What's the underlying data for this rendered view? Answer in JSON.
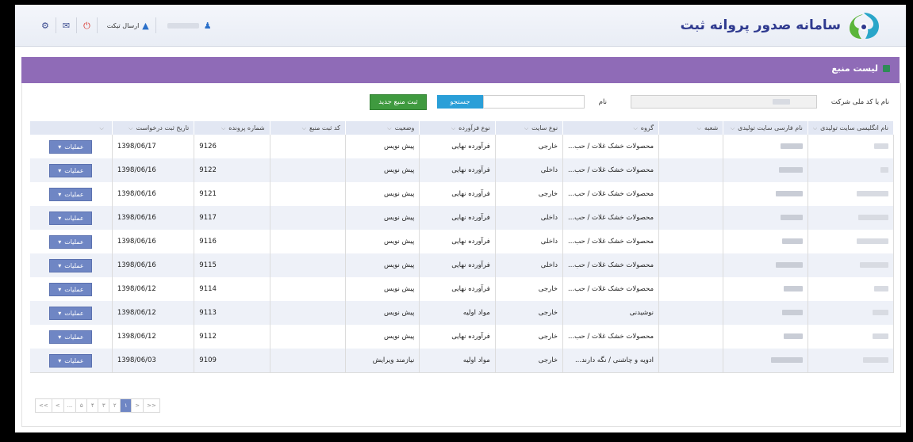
{
  "header": {
    "brand_title": "سامانه صدور پروانه ثبت",
    "send_ticket_label": "ارسال تیکت"
  },
  "page": {
    "title": "لیست منبع"
  },
  "search": {
    "company_label": "نام یا کد ملی شرکت",
    "name_label": "نام",
    "search_button": "جستجو",
    "new_button": "ثبت منبع جدید"
  },
  "table": {
    "columns": [
      "نام انگلیسی سایت تولیدی",
      "نام فارسی سایت تولیدی",
      "شعبه",
      "گروه",
      "نوع سایت",
      "نوع فرآورده",
      "وضعیت",
      "کد ثبت منبع",
      "شماره پرونده",
      "تاریخ ثبت درخواست",
      ""
    ],
    "ops_label": "عملیات",
    "rows": [
      {
        "group": "محصولات خشک غلات / حب...",
        "site_type": "خارجی",
        "product_type": "فرآورده نهایی",
        "status": "پیش نویس",
        "file_no": "9126",
        "date": "1398/06/17"
      },
      {
        "group": "محصولات خشک غلات / حب...",
        "site_type": "داخلی",
        "product_type": "فرآورده نهایی",
        "status": "پیش نویس",
        "file_no": "9122",
        "date": "1398/06/16"
      },
      {
        "group": "محصولات خشک غلات / حب...",
        "site_type": "خارجی",
        "product_type": "فرآورده نهایی",
        "status": "پیش نویس",
        "file_no": "9121",
        "date": "1398/06/16"
      },
      {
        "group": "محصولات خشک غلات / حب...",
        "site_type": "داخلی",
        "product_type": "فرآورده نهایی",
        "status": "پیش نویس",
        "file_no": "9117",
        "date": "1398/06/16"
      },
      {
        "group": "محصولات خشک غلات / حب...",
        "site_type": "داخلی",
        "product_type": "فرآورده نهایی",
        "status": "پیش نویس",
        "file_no": "9116",
        "date": "1398/06/16"
      },
      {
        "group": "محصولات خشک غلات / حب...",
        "site_type": "داخلی",
        "product_type": "فرآورده نهایی",
        "status": "پیش نویس",
        "file_no": "9115",
        "date": "1398/06/16"
      },
      {
        "group": "محصولات خشک غلات / حب...",
        "site_type": "خارجی",
        "product_type": "فرآورده نهایی",
        "status": "پیش نویس",
        "file_no": "9114",
        "date": "1398/06/12"
      },
      {
        "group": "نوشیدنی",
        "site_type": "خارجی",
        "product_type": "مواد اولیه",
        "status": "پیش نویس",
        "file_no": "9113",
        "date": "1398/06/12"
      },
      {
        "group": "محصولات خشک غلات / حب...",
        "site_type": "خارجی",
        "product_type": "فرآورده نهایی",
        "status": "پیش نویس",
        "file_no": "9112",
        "date": "1398/06/12"
      },
      {
        "group": "ادویه و چاشنی / نگه دارند...",
        "site_type": "خارجی",
        "product_type": "مواد اولیه",
        "status": "نیازمند ویرایش",
        "file_no": "9109",
        "date": "1398/06/03"
      }
    ]
  },
  "pagination": {
    "items": [
      "<<",
      "<",
      "...",
      "۵",
      "۴",
      "۳",
      "۲",
      "۱",
      ">",
      ">>"
    ],
    "active_index": 7
  },
  "colors": {
    "title_bar": "#8f6bb7",
    "header_row": "#e2e7f3",
    "alt_row": "#eef1f8",
    "ops_button": "#6f86c4",
    "search_button": "#2a9fd8",
    "new_button": "#3f9a3f"
  }
}
